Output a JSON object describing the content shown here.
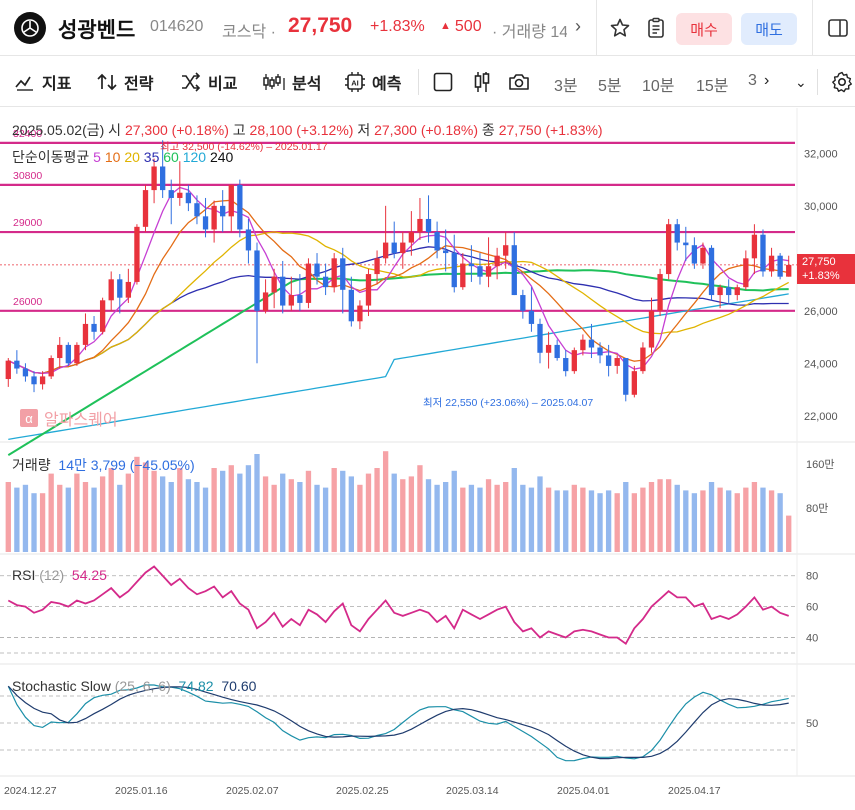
{
  "header": {
    "stock_name": "성광벤드",
    "stock_code": "014620",
    "market": "코스닥 ·",
    "price": "27,750",
    "change_pct": "+1.83%",
    "change_abs": "500",
    "volume_label": "· 거래량 14",
    "buy_label": "매수",
    "sell_label": "매도",
    "icons": [
      "logo-icon",
      "chevron-right-icon",
      "star-icon",
      "memo-icon",
      "panel-icon"
    ]
  },
  "toolbar": {
    "indicator_label": "지표",
    "strategy_label": "전략",
    "compare_label": "비교",
    "analysis_label": "분석",
    "forecast_label": "예측",
    "intervals": [
      "3분",
      "5분",
      "10분",
      "15분",
      "3"
    ],
    "colors": {
      "up": "#e8323c",
      "down": "#2f6fe0",
      "accent": "#d42a8a"
    }
  },
  "info": {
    "date": "2025.05.02(금)",
    "open_label": "시",
    "open": "27,300 (+0.18%)",
    "high_label": "고",
    "high": "28,100 (+3.12%)",
    "low_label": "저",
    "low": "27,300 (+0.18%)",
    "close_label": "종",
    "close": "27,750 (+1.83%)",
    "ma_label": "단순이동평균",
    "ma_periods": [
      "5",
      "10",
      "20",
      "35",
      "60",
      "120",
      "240"
    ],
    "ma_colors": [
      "#c63fd3",
      "#e46d16",
      "#e0b400",
      "#2e2fb0",
      "#1fc15a",
      "#22a9d6",
      "#111111"
    ],
    "watermark": "알파스퀘어",
    "max_note": "최고 32,500 (-14.62%) – 2025.01.17",
    "min_note": "최저 22,550 (+23.06%) – 2025.04.07",
    "last_price": "27,750",
    "last_pct": "+1.83%"
  },
  "volume": {
    "label": "거래량",
    "value": "14만 3,799 (−45.05%)"
  },
  "rsi": {
    "label": "RSI",
    "param": "(12)",
    "value": "54.25"
  },
  "stochastic": {
    "label": "Stochastic Slow",
    "param": "(25, 6, 6)",
    "k": "74.82",
    "d": "70.60"
  },
  "chart_data": {
    "type": "candlestick",
    "price_axis": [
      "32,000",
      "30,000",
      "28,000",
      "26,000",
      "24,000",
      "22,000"
    ],
    "price_range": [
      21000,
      33500
    ],
    "levels": [
      32400,
      30800,
      29000,
      26000
    ],
    "volume_axis": [
      "160만",
      "80만"
    ],
    "volume_max": 1750000,
    "rsi_axis": [
      "80",
      "60",
      "40"
    ],
    "stoch_axis": [
      "50"
    ],
    "x_labels": [
      "2024.12.27",
      "2025.01.16",
      "2025.02.07",
      "2025.02.25",
      "2025.03.14",
      "2025.04.01",
      "2025.04.17"
    ],
    "candles": [
      [
        23400,
        24200,
        23100,
        24100
      ],
      [
        24100,
        24500,
        23600,
        23800
      ],
      [
        23800,
        24000,
        23300,
        23500
      ],
      [
        23500,
        23700,
        22900,
        23200
      ],
      [
        23200,
        23700,
        23000,
        23500
      ],
      [
        23500,
        24300,
        23400,
        24200
      ],
      [
        24200,
        25000,
        23800,
        24700
      ],
      [
        24700,
        24800,
        23900,
        24000
      ],
      [
        24000,
        24800,
        23900,
        24700
      ],
      [
        24700,
        25900,
        24500,
        25500
      ],
      [
        25500,
        25800,
        24900,
        25200
      ],
      [
        25200,
        26500,
        25100,
        26400
      ],
      [
        26400,
        27500,
        26000,
        27200
      ],
      [
        27200,
        27400,
        25900,
        26500
      ],
      [
        26500,
        27600,
        26300,
        27100
      ],
      [
        27100,
        29300,
        27000,
        29200
      ],
      [
        29200,
        30800,
        29000,
        30600
      ],
      [
        30600,
        31800,
        30100,
        31500
      ],
      [
        31500,
        32500,
        30300,
        30600
      ],
      [
        30600,
        31000,
        29300,
        30300
      ],
      [
        30300,
        31700,
        30000,
        30500
      ],
      [
        30500,
        30800,
        29800,
        30100
      ],
      [
        30100,
        30400,
        29300,
        29600
      ],
      [
        29600,
        30300,
        28800,
        29100
      ],
      [
        29100,
        30200,
        28600,
        30000
      ],
      [
        30000,
        30600,
        29000,
        29600
      ],
      [
        29600,
        30800,
        29000,
        30800
      ],
      [
        30800,
        31000,
        28800,
        29100
      ],
      [
        29100,
        29500,
        27800,
        28300
      ],
      [
        28300,
        28600,
        24000,
        26000
      ],
      [
        26000,
        27200,
        25900,
        26700
      ],
      [
        26700,
        27600,
        26100,
        27300
      ],
      [
        27300,
        27900,
        25900,
        26200
      ],
      [
        26200,
        27300,
        26000,
        26600
      ],
      [
        26600,
        27400,
        26000,
        26300
      ],
      [
        26300,
        28000,
        26100,
        27800
      ],
      [
        27800,
        28200,
        27000,
        27300
      ],
      [
        27300,
        27800,
        26600,
        26900
      ],
      [
        26900,
        28200,
        26700,
        28000
      ],
      [
        28000,
        28400,
        25900,
        26800
      ],
      [
        26800,
        27300,
        25400,
        25600
      ],
      [
        25600,
        26400,
        25300,
        26200
      ],
      [
        26200,
        27600,
        25800,
        27400
      ],
      [
        27400,
        28300,
        27000,
        28000
      ],
      [
        28000,
        30000,
        27800,
        28600
      ],
      [
        28600,
        29400,
        28000,
        28200
      ],
      [
        28200,
        29000,
        27600,
        28600
      ],
      [
        28600,
        29800,
        28100,
        29000
      ],
      [
        29000,
        30300,
        28700,
        29500
      ],
      [
        29500,
        30400,
        28600,
        29000
      ],
      [
        29000,
        29400,
        28000,
        28300
      ],
      [
        28300,
        29100,
        27500,
        28200
      ],
      [
        28200,
        28900,
        26700,
        26900
      ],
      [
        26900,
        28200,
        26800,
        27800
      ],
      [
        27800,
        28500,
        27100,
        27700
      ],
      [
        27700,
        28200,
        27000,
        27300
      ],
      [
        27300,
        28800,
        26900,
        27700
      ],
      [
        27700,
        28400,
        27200,
        28100
      ],
      [
        28100,
        29000,
        27600,
        28500
      ],
      [
        28500,
        29000,
        26600,
        26600
      ],
      [
        26600,
        26800,
        25700,
        26000
      ],
      [
        26000,
        26900,
        25200,
        25500
      ],
      [
        25500,
        25700,
        24000,
        24400
      ],
      [
        24400,
        25200,
        23800,
        24700
      ],
      [
        24700,
        24900,
        24100,
        24200
      ],
      [
        24200,
        24500,
        23500,
        23700
      ],
      [
        23700,
        24600,
        23600,
        24500
      ],
      [
        24500,
        25100,
        24300,
        24900
      ],
      [
        24900,
        25500,
        24200,
        24600
      ],
      [
        24600,
        24800,
        24000,
        24300
      ],
      [
        24300,
        24700,
        23500,
        23900
      ],
      [
        23900,
        24300,
        23600,
        24200
      ],
      [
        24200,
        24200,
        22550,
        22800
      ],
      [
        22800,
        23900,
        22700,
        23700
      ],
      [
        23700,
        24800,
        23600,
        24600
      ],
      [
        24600,
        26500,
        24400,
        26000
      ],
      [
        26000,
        27600,
        25800,
        27400
      ],
      [
        27400,
        29500,
        27200,
        29300
      ],
      [
        29300,
        29500,
        28300,
        28600
      ],
      [
        28600,
        29200,
        27900,
        28500
      ],
      [
        28500,
        28800,
        27600,
        27800
      ],
      [
        27800,
        28600,
        27600,
        28400
      ],
      [
        28400,
        28500,
        26400,
        26600
      ],
      [
        26600,
        27000,
        26100,
        26900
      ],
      [
        26900,
        27200,
        26300,
        26600
      ],
      [
        26600,
        27000,
        26400,
        26900
      ],
      [
        26900,
        28300,
        26800,
        28000
      ],
      [
        28000,
        29300,
        27400,
        28900
      ],
      [
        28900,
        29100,
        27300,
        27500
      ],
      [
        27500,
        28400,
        27300,
        28100
      ],
      [
        28100,
        28200,
        27200,
        27300
      ],
      [
        27300,
        28100,
        27300,
        27750
      ]
    ],
    "volumes": [
      1250000,
      1150000,
      1200000,
      1050000,
      1050000,
      1400000,
      1200000,
      1150000,
      1400000,
      1250000,
      1150000,
      1350000,
      1500000,
      1200000,
      1400000,
      1700000,
      1600000,
      1450000,
      1350000,
      1250000,
      1500000,
      1300000,
      1250000,
      1150000,
      1500000,
      1450000,
      1550000,
      1400000,
      1550000,
      1750000,
      1350000,
      1200000,
      1400000,
      1300000,
      1250000,
      1450000,
      1200000,
      1150000,
      1500000,
      1450000,
      1350000,
      1200000,
      1400000,
      1500000,
      1800000,
      1400000,
      1300000,
      1350000,
      1550000,
      1300000,
      1200000,
      1250000,
      1450000,
      1150000,
      1200000,
      1150000,
      1300000,
      1200000,
      1250000,
      1500000,
      1200000,
      1150000,
      1350000,
      1150000,
      1100000,
      1100000,
      1200000,
      1150000,
      1100000,
      1050000,
      1100000,
      1050000,
      1250000,
      1050000,
      1150000,
      1250000,
      1300000,
      1300000,
      1200000,
      1100000,
      1050000,
      1100000,
      1250000,
      1150000,
      1100000,
      1050000,
      1150000,
      1250000,
      1150000,
      1100000,
      1050000,
      650000
    ],
    "rsi_values": [
      64,
      61,
      60,
      56,
      58,
      63,
      62,
      60,
      64,
      62,
      64,
      68,
      72,
      66,
      70,
      76,
      82,
      86,
      80,
      74,
      78,
      72,
      68,
      70,
      73,
      66,
      70,
      62,
      58,
      46,
      50,
      56,
      47,
      52,
      48,
      58,
      55,
      50,
      57,
      62,
      48,
      44,
      52,
      58,
      64,
      56,
      54,
      56,
      58,
      56,
      50,
      54,
      46,
      58,
      55,
      52,
      55,
      58,
      60,
      50,
      44,
      46,
      40,
      44,
      42,
      40,
      44,
      45,
      44,
      42,
      40,
      40,
      36,
      46,
      52,
      60,
      65,
      70,
      66,
      66,
      60,
      62,
      52,
      54,
      52,
      55,
      60,
      66,
      58,
      60,
      56,
      54
    ]
  }
}
